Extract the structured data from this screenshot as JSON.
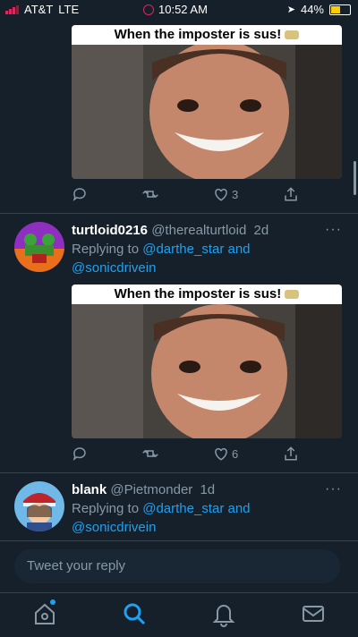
{
  "status_bar": {
    "carrier": "AT&T",
    "network": "LTE",
    "time": "10:52 AM",
    "battery": "44%",
    "battery_level": 0.44
  },
  "tweets": [
    {
      "image_caption": "When the imposter is sus!",
      "actions": {
        "reply": "",
        "retweet": "",
        "like": "3",
        "share": ""
      }
    },
    {
      "display_name": "turtloid0216",
      "handle": "@therealturtloid",
      "time": "2d",
      "replying_prefix": "Replying to",
      "replying_to": [
        "@darthe_star",
        "@sonicdrivein"
      ],
      "and_word": "and",
      "image_caption": "When the imposter is sus!",
      "actions": {
        "reply": "",
        "retweet": "",
        "like": "6",
        "share": ""
      }
    },
    {
      "display_name": "blank",
      "handle": "@Pietmonder",
      "time": "1d",
      "replying_prefix": "Replying to",
      "replying_to": [
        "@darthe_star",
        "@sonicdrivein"
      ],
      "and_word": "and"
    }
  ],
  "reply_input": {
    "placeholder": "Tweet your reply"
  },
  "tab_bar": {
    "items": [
      "home-icon",
      "search-icon",
      "notifications-icon",
      "messages-icon"
    ],
    "active": "search-icon",
    "accent": "#1da1f2"
  },
  "colors": {
    "background": "#15202b",
    "accent": "#1da1f2",
    "muted": "#8899a6"
  }
}
